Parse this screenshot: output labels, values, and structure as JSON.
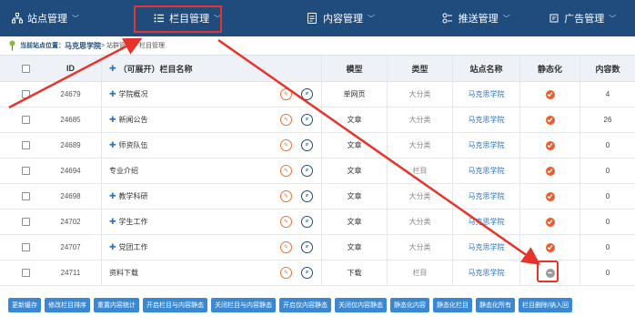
{
  "nav": {
    "items": [
      {
        "label": "站点管理",
        "icon": "sitemap-icon"
      },
      {
        "label": "栏目管理",
        "icon": "list-icon"
      },
      {
        "label": "内容管理",
        "icon": "document-icon"
      },
      {
        "label": "推送管理",
        "icon": "push-icon"
      },
      {
        "label": "广告管理",
        "icon": "ad-icon"
      }
    ]
  },
  "breadcrumb": {
    "label": "当前站点位置：",
    "site": "马克思学院",
    "path": " > 站群管理 > 栏目管理"
  },
  "table": {
    "headers": {
      "id": "ID",
      "name": "（可展开）栏目名称",
      "type": "模型",
      "category": "类型",
      "site": "站点名称",
      "static": "静态化",
      "count": "内容数"
    },
    "rows": [
      {
        "id": "24679",
        "name": "学院概况",
        "expandable": true,
        "type": "单网页",
        "category": "大分类",
        "site": "马克思学院",
        "static": true,
        "count": "4"
      },
      {
        "id": "24685",
        "name": "新闻公告",
        "expandable": true,
        "type": "文章",
        "category": "大分类",
        "site": "马克思学院",
        "static": true,
        "count": "26"
      },
      {
        "id": "24689",
        "name": "师资队伍",
        "expandable": true,
        "type": "文章",
        "category": "大分类",
        "site": "马克思学院",
        "static": true,
        "count": "0"
      },
      {
        "id": "24694",
        "name": "专业介绍",
        "expandable": false,
        "type": "文章",
        "category": "栏目",
        "site": "马克思学院",
        "static": true,
        "count": "0"
      },
      {
        "id": "24698",
        "name": "教学科研",
        "expandable": true,
        "type": "文章",
        "category": "大分类",
        "site": "马克思学院",
        "static": true,
        "count": "0"
      },
      {
        "id": "24702",
        "name": "学生工作",
        "expandable": true,
        "type": "文章",
        "category": "大分类",
        "site": "马克思学院",
        "static": true,
        "count": "0"
      },
      {
        "id": "24707",
        "name": "党团工作",
        "expandable": true,
        "type": "文章",
        "category": "大分类",
        "site": "马克思学院",
        "static": true,
        "count": "0"
      },
      {
        "id": "24711",
        "name": "资料下载",
        "expandable": false,
        "type": "下载",
        "category": "栏目",
        "site": "马克思学院",
        "static": false,
        "count": "0"
      }
    ]
  },
  "buttons": [
    "更新缓存",
    "修改栏目排序",
    "重置内容统计",
    "开启栏目与内容静态",
    "关闭栏目与内容静态",
    "开启仅内容静态",
    "关闭仅内容静态",
    "静态化内容",
    "静态化栏目",
    "静态化所有",
    "栏目删除/纳入回"
  ],
  "colors": {
    "nav_bg": "#1f4b7d",
    "highlight": "#e8332d",
    "static_on": "#ec5d2c",
    "static_off": "#9a9a9a",
    "button_bg": "#3a88d4"
  }
}
